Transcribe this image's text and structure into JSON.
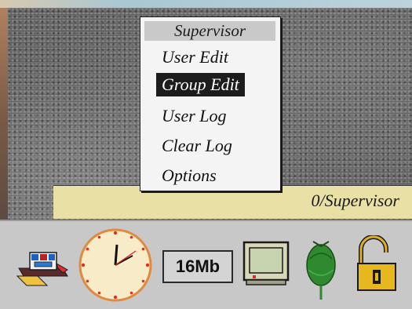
{
  "menu": {
    "title": "Supervisor",
    "items": [
      {
        "label": "User Edit",
        "selected": false
      },
      {
        "label": "Group Edit",
        "selected": true
      },
      {
        "label": "User Log",
        "selected": false
      },
      {
        "label": "Clear Log",
        "selected": false
      },
      {
        "label": "Options",
        "selected": false
      }
    ]
  },
  "status": {
    "text": "0/Supervisor",
    "bg_color": "#e9e0a5"
  },
  "iconbar": {
    "memory_label": "16Mb",
    "icons": [
      "network-printer-icon",
      "clock-icon",
      "memory-indicator",
      "monitor-icon",
      "acorn-icon",
      "padlock-icon"
    ]
  },
  "colors": {
    "selection": "#1c1c1c",
    "clock_face": "#f8ecc8",
    "clock_ring": "#e08a40",
    "acorn": "#2f8a2f",
    "padlock_body": "#e6b81e"
  }
}
